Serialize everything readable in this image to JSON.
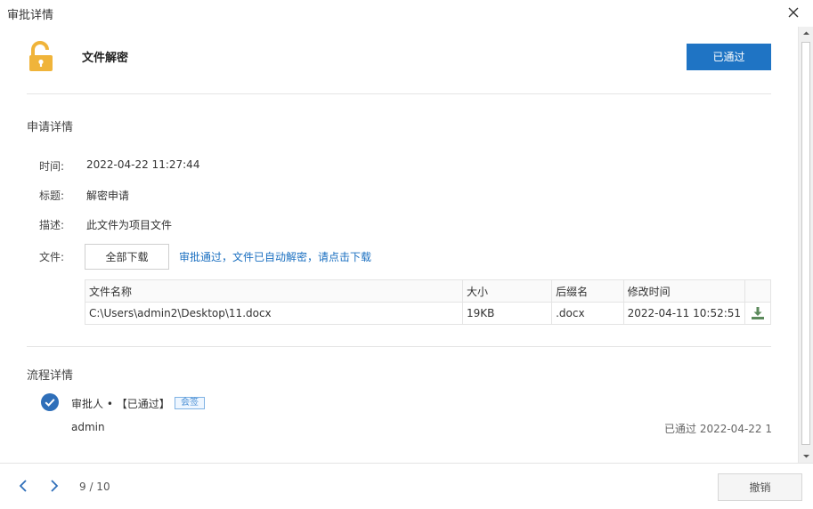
{
  "dialog": {
    "title": "审批详情"
  },
  "header": {
    "doc_title": "文件解密",
    "status_label": "已通过"
  },
  "apply_section": {
    "title": "申请详情",
    "fields": [
      {
        "label": "时间:",
        "value": "2022-04-22 11:27:44"
      },
      {
        "label": "标题:",
        "value": "解密申请"
      },
      {
        "label": "描述:",
        "value": "此文件为项目文件"
      }
    ],
    "file_label": "文件:",
    "download_all_label": "全部下载",
    "download_hint": "审批通过，文件已自动解密，请点击下载"
  },
  "file_table": {
    "columns": [
      "文件名称",
      "大小",
      "后缀名",
      "修改时间"
    ],
    "rows": [
      {
        "name": "C:\\Users\\admin2\\Desktop\\11.docx",
        "size": "19KB",
        "ext": ".docx",
        "modified": "2022-04-11 10:52:51"
      }
    ],
    "download_icon": "download-icon"
  },
  "flow_section": {
    "title": "流程详情",
    "approver_label": "审批人 • 【已通过】",
    "badge": "会签",
    "approver_name": "admin",
    "approve_time": "已通过 2022-04-22 1"
  },
  "footer": {
    "pager": "9 / 10",
    "revoke_label": "撤销"
  },
  "colors": {
    "primary": "#1f74c4",
    "lock": "#f0b43a",
    "check": "#2f6fb9",
    "download_icon": "#5c8a5c"
  }
}
